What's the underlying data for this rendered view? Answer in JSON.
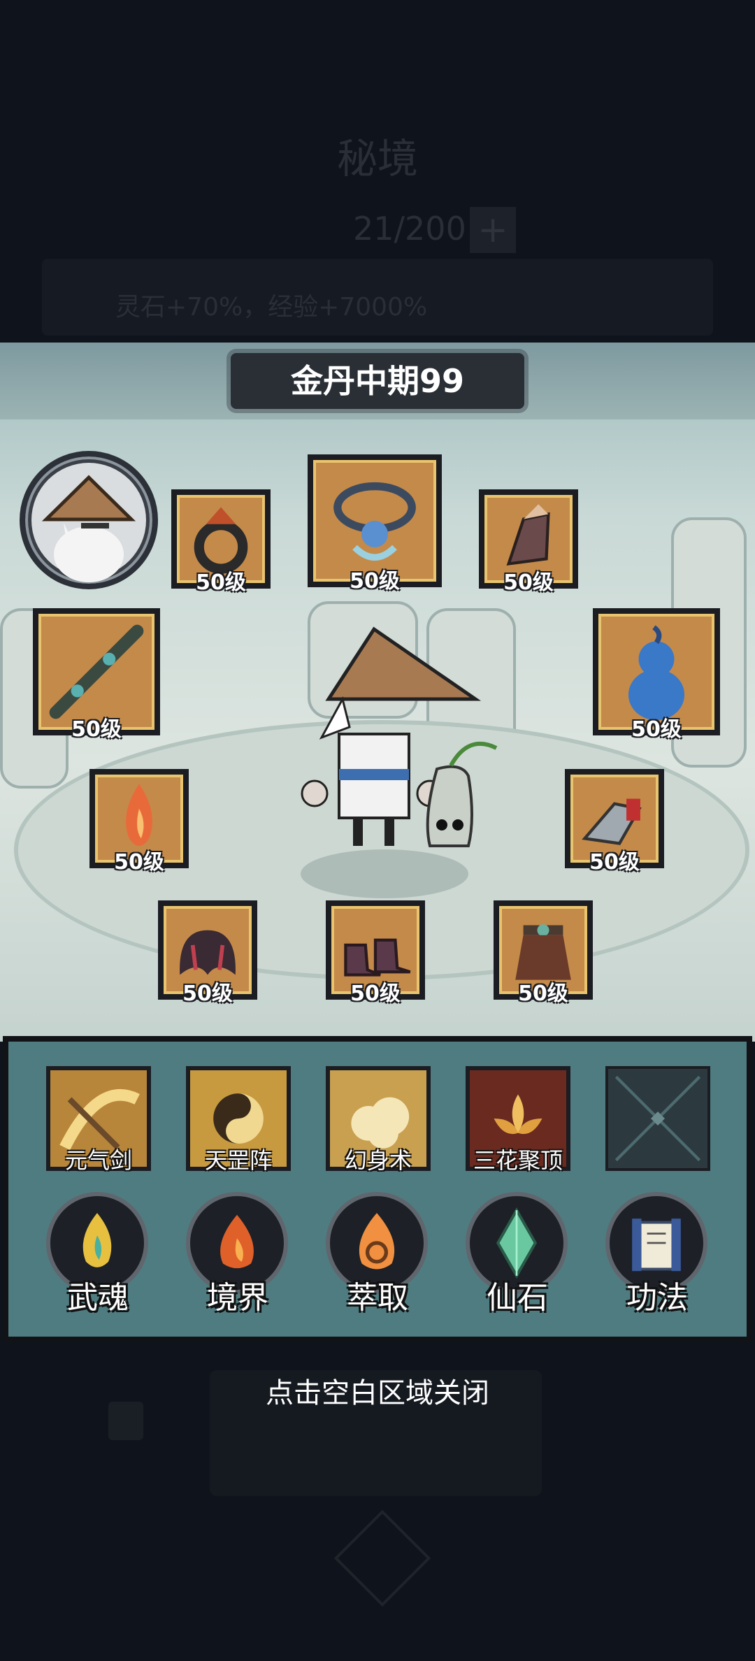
{
  "background": {
    "title": "秘境",
    "count": "21/200",
    "bonus": "灵石+70%，经验+7000%"
  },
  "panel": {
    "realm_title": "金丹中期99"
  },
  "equipment": [
    {
      "name": "ring",
      "level": "50级",
      "icon": "ring-icon"
    },
    {
      "name": "necklace",
      "level": "50级",
      "icon": "necklace-icon"
    },
    {
      "name": "bracer",
      "level": "50级",
      "icon": "bracer-icon"
    },
    {
      "name": "weapon",
      "level": "50级",
      "icon": "staff-icon"
    },
    {
      "name": "gourd",
      "level": "50级",
      "icon": "gourd-icon"
    },
    {
      "name": "flame",
      "level": "50级",
      "icon": "flame-icon"
    },
    {
      "name": "armguard",
      "level": "50级",
      "icon": "armguard-icon"
    },
    {
      "name": "wings",
      "level": "50级",
      "icon": "wings-icon"
    },
    {
      "name": "boots",
      "level": "50级",
      "icon": "boots-icon"
    },
    {
      "name": "skirt",
      "level": "50级",
      "icon": "skirt-icon"
    }
  ],
  "skills": [
    {
      "label": "元气剑",
      "icon": "sword-qi-icon"
    },
    {
      "label": "天罡阵",
      "icon": "yin-yang-icon"
    },
    {
      "label": "幻身术",
      "icon": "cloud-icon"
    },
    {
      "label": "三花聚顶",
      "icon": "lotus-icon"
    },
    {
      "label": "",
      "icon": "empty-slot-icon"
    }
  ],
  "actions": [
    {
      "label": "武魂",
      "icon": "spirit-flame-icon"
    },
    {
      "label": "境界",
      "icon": "fire-icon"
    },
    {
      "label": "萃取",
      "icon": "extract-flame-icon"
    },
    {
      "label": "仙石",
      "icon": "crystal-icon"
    },
    {
      "label": "功法",
      "icon": "scroll-icon"
    }
  ],
  "close_hint": "点击空白区域关闭",
  "colors": {
    "slot_fill": "#c48a4a",
    "slot_border": "#e9c46e",
    "skill_panel": "#4f7c81"
  }
}
